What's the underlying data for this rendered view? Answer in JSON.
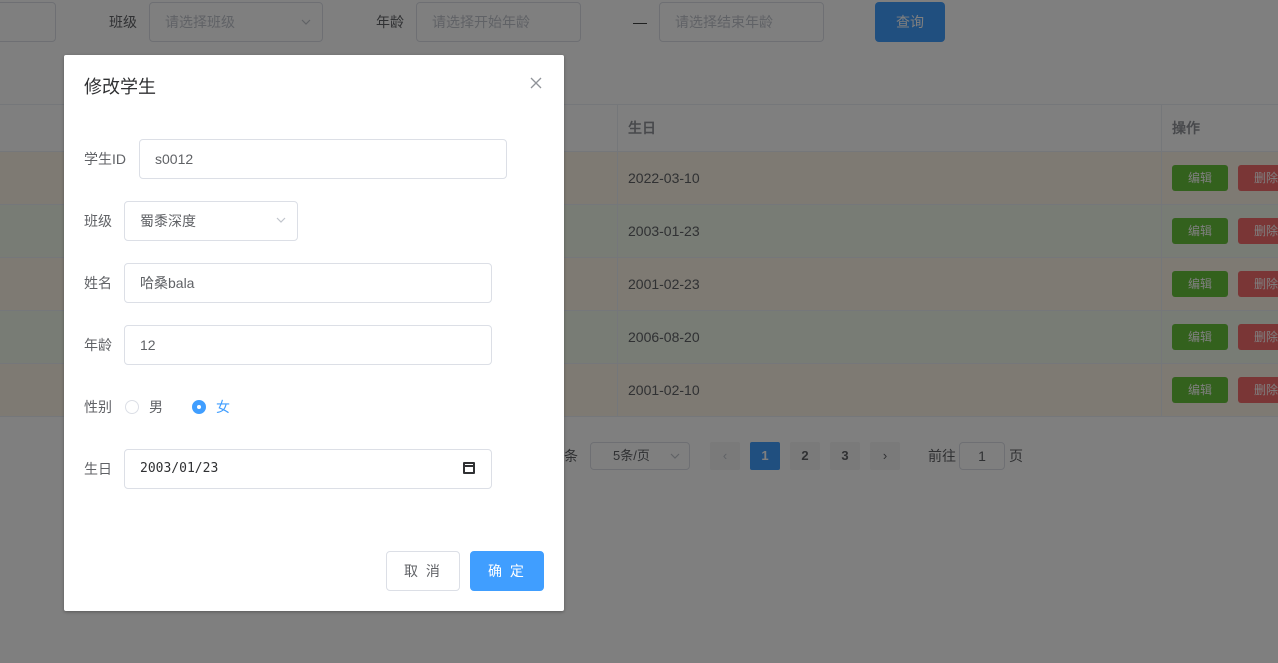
{
  "filters": {
    "class_label": "班级",
    "class_placeholder": "请选择班级",
    "age_label": "年龄",
    "age_start_placeholder": "请选择开始年龄",
    "age_separator": "—",
    "age_end_placeholder": "请选择结束年龄",
    "query_label": "查询"
  },
  "table": {
    "headers": {
      "birthday": "生日",
      "actions": "操作"
    },
    "rows": [
      {
        "birthday": "2022-03-10",
        "edit": "编辑",
        "delete": "删除"
      },
      {
        "birthday": "2003-01-23",
        "edit": "编辑",
        "delete": "删除"
      },
      {
        "birthday": "2001-02-23",
        "edit": "编辑",
        "delete": "删除"
      },
      {
        "birthday": "2006-08-20",
        "edit": "编辑",
        "delete": "删除"
      },
      {
        "birthday": "2001-02-10",
        "edit": "编辑",
        "delete": "删除"
      }
    ]
  },
  "pagination": {
    "total_suffix": "条",
    "page_size": "5条/页",
    "prev": "‹",
    "pages": [
      "1",
      "2",
      "3"
    ],
    "current_page": "1",
    "next": "›",
    "goto_prefix": "前往",
    "goto_value": "1",
    "goto_suffix": "页"
  },
  "dialog": {
    "title": "修改学生",
    "close": "×",
    "fields": {
      "student_id_label": "学生ID",
      "student_id_value": "s0012",
      "class_label": "班级",
      "class_value": "蜀黍深度",
      "name_label": "姓名",
      "name_value": "哈桑bala",
      "age_label": "年龄",
      "age_value": "12",
      "gender_label": "性别",
      "gender_options": [
        "男",
        "女"
      ],
      "gender_selected": "女",
      "birthday_label": "生日",
      "birthday_value": "2003/01/23"
    },
    "cancel_label": "取 消",
    "confirm_label": "确 定"
  }
}
